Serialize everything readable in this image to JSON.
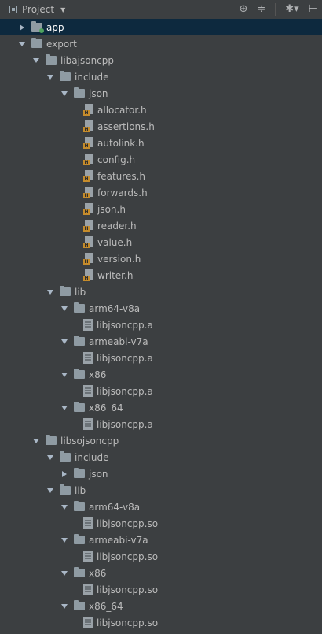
{
  "toolbar": {
    "title": "Project",
    "dropdown_icon": "caret-down-icon",
    "actions": [
      "crosshair-icon",
      "collapse-all-icon",
      "settings-icon",
      "hide-panel-icon"
    ]
  },
  "tree": [
    {
      "label": "app",
      "type": "module",
      "expanded": false,
      "level": 0,
      "selected": true
    },
    {
      "label": "export",
      "type": "folder",
      "expanded": true,
      "level": 0
    },
    {
      "label": "libajsoncpp",
      "type": "folder",
      "expanded": true,
      "level": 1
    },
    {
      "label": "include",
      "type": "folder",
      "expanded": true,
      "level": 2
    },
    {
      "label": "json",
      "type": "folder",
      "expanded": true,
      "level": 3
    },
    {
      "label": "allocator.h",
      "type": "header",
      "level": 4
    },
    {
      "label": "assertions.h",
      "type": "header",
      "level": 4
    },
    {
      "label": "autolink.h",
      "type": "header",
      "level": 4
    },
    {
      "label": "config.h",
      "type": "header",
      "level": 4
    },
    {
      "label": "features.h",
      "type": "header",
      "level": 4
    },
    {
      "label": "forwards.h",
      "type": "header",
      "level": 4
    },
    {
      "label": "json.h",
      "type": "header",
      "level": 4
    },
    {
      "label": "reader.h",
      "type": "header",
      "level": 4
    },
    {
      "label": "value.h",
      "type": "header",
      "level": 4
    },
    {
      "label": "version.h",
      "type": "header",
      "level": 4
    },
    {
      "label": "writer.h",
      "type": "header",
      "level": 4
    },
    {
      "label": "lib",
      "type": "folder",
      "expanded": true,
      "level": 2
    },
    {
      "label": "arm64-v8a",
      "type": "folder",
      "expanded": true,
      "level": 3
    },
    {
      "label": "libjsoncpp.a",
      "type": "lib",
      "level": 4
    },
    {
      "label": "armeabi-v7a",
      "type": "folder",
      "expanded": true,
      "level": 3
    },
    {
      "label": "libjsoncpp.a",
      "type": "lib",
      "level": 4
    },
    {
      "label": "x86",
      "type": "folder",
      "expanded": true,
      "level": 3
    },
    {
      "label": "libjsoncpp.a",
      "type": "lib",
      "level": 4
    },
    {
      "label": "x86_64",
      "type": "folder",
      "expanded": true,
      "level": 3
    },
    {
      "label": "libjsoncpp.a",
      "type": "lib",
      "level": 4
    },
    {
      "label": "libsojsoncpp",
      "type": "folder",
      "expanded": true,
      "level": 1
    },
    {
      "label": "include",
      "type": "folder",
      "expanded": true,
      "level": 2
    },
    {
      "label": "json",
      "type": "folder",
      "expanded": false,
      "level": 3
    },
    {
      "label": "lib",
      "type": "folder",
      "expanded": true,
      "level": 2
    },
    {
      "label": "arm64-v8a",
      "type": "folder",
      "expanded": true,
      "level": 3
    },
    {
      "label": "libjsoncpp.so",
      "type": "lib",
      "level": 4
    },
    {
      "label": "armeabi-v7a",
      "type": "folder",
      "expanded": true,
      "level": 3
    },
    {
      "label": "libjsoncpp.so",
      "type": "lib",
      "level": 4
    },
    {
      "label": "x86",
      "type": "folder",
      "expanded": true,
      "level": 3
    },
    {
      "label": "libjsoncpp.so",
      "type": "lib",
      "level": 4
    },
    {
      "label": "x86_64",
      "type": "folder",
      "expanded": true,
      "level": 3
    },
    {
      "label": "libjsoncpp.so",
      "type": "lib",
      "level": 4
    }
  ]
}
